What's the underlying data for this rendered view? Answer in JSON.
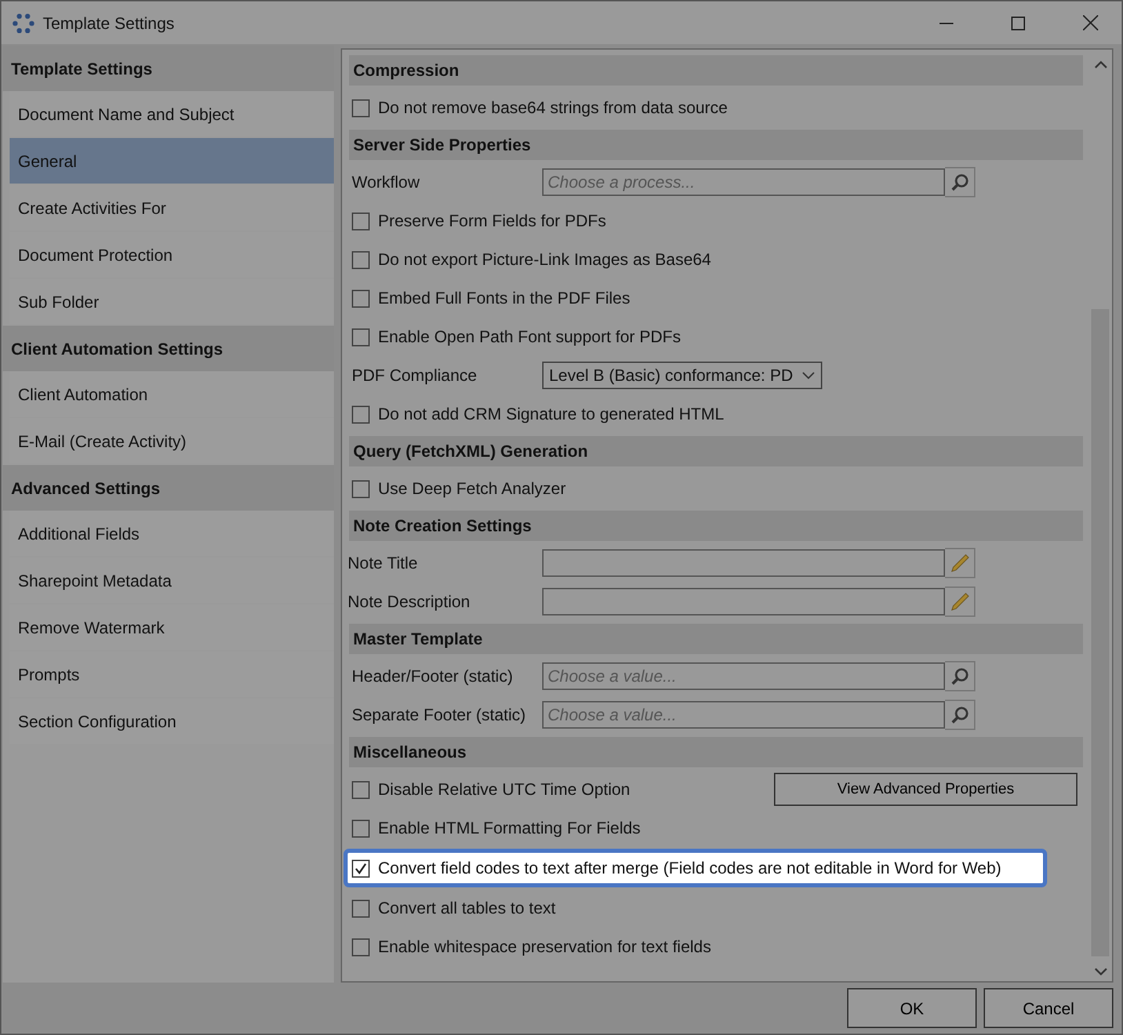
{
  "window": {
    "title": "Template Settings"
  },
  "sidebar": [
    {
      "title": "Template Settings",
      "items": [
        {
          "label": "Document Name and Subject",
          "selected": false
        },
        {
          "label": "General",
          "selected": true
        },
        {
          "label": "Create Activities For",
          "selected": false
        },
        {
          "label": "Document Protection",
          "selected": false
        },
        {
          "label": "Sub Folder",
          "selected": false
        }
      ]
    },
    {
      "title": "Client Automation Settings",
      "items": [
        {
          "label": "Client Automation",
          "selected": false
        },
        {
          "label": "E-Mail (Create Activity)",
          "selected": false
        }
      ]
    },
    {
      "title": "Advanced Settings",
      "items": [
        {
          "label": "Additional Fields",
          "selected": false
        },
        {
          "label": "Sharepoint Metadata",
          "selected": false
        },
        {
          "label": "Remove Watermark",
          "selected": false
        },
        {
          "label": "Prompts",
          "selected": false
        },
        {
          "label": "Section Configuration",
          "selected": false
        }
      ]
    }
  ],
  "rows": [
    {
      "kind": "header",
      "label": "Compression"
    },
    {
      "kind": "checkbox",
      "label": "Do not remove base64 strings from data source",
      "checked": false
    },
    {
      "kind": "header",
      "label": "Server Side Properties"
    },
    {
      "kind": "lookup",
      "label": "Workflow",
      "placeholder": "Choose a process..."
    },
    {
      "kind": "checkbox",
      "label": "Preserve Form Fields for PDFs",
      "checked": false
    },
    {
      "kind": "checkbox",
      "label": "Do not export Picture-Link Images as Base64",
      "checked": false
    },
    {
      "kind": "checkbox",
      "label": "Embed Full Fonts in the PDF Files",
      "checked": false
    },
    {
      "kind": "checkbox",
      "label": "Enable Open Path Font support for PDFs",
      "checked": false
    },
    {
      "kind": "select",
      "label": "PDF Compliance",
      "value": "Level B (Basic) conformance: PD"
    },
    {
      "kind": "checkbox",
      "label": "Do not add CRM Signature to generated HTML",
      "checked": false
    },
    {
      "kind": "header",
      "label": "Query (FetchXML) Generation"
    },
    {
      "kind": "checkbox",
      "label": "Use Deep Fetch Analyzer",
      "checked": false
    },
    {
      "kind": "header",
      "label": "Note Creation Settings"
    },
    {
      "kind": "edit",
      "label": "Note Title"
    },
    {
      "kind": "edit",
      "label": "Note Description"
    },
    {
      "kind": "header",
      "label": "Master Template"
    },
    {
      "kind": "lookup",
      "label": "Header/Footer (static)",
      "placeholder": "Choose a value..."
    },
    {
      "kind": "lookup",
      "label": "Separate Footer (static)",
      "placeholder": "Choose a value..."
    },
    {
      "kind": "header",
      "label": "Miscellaneous"
    },
    {
      "kind": "checkbox",
      "label": "Disable Relative UTC Time Option",
      "checked": false,
      "button": "View Advanced Properties"
    },
    {
      "kind": "checkbox",
      "label": "Enable HTML Formatting For Fields",
      "checked": false
    },
    {
      "kind": "checkbox",
      "label": "Convert field codes to text after merge (Field codes are not editable in Word for Web)",
      "checked": true,
      "highlighted": true
    },
    {
      "kind": "checkbox",
      "label": "Convert all tables to text",
      "checked": false
    },
    {
      "kind": "checkbox",
      "label": "Enable whitespace preservation for text fields",
      "checked": false
    }
  ],
  "buttons": [
    "OK",
    "Cancel"
  ]
}
